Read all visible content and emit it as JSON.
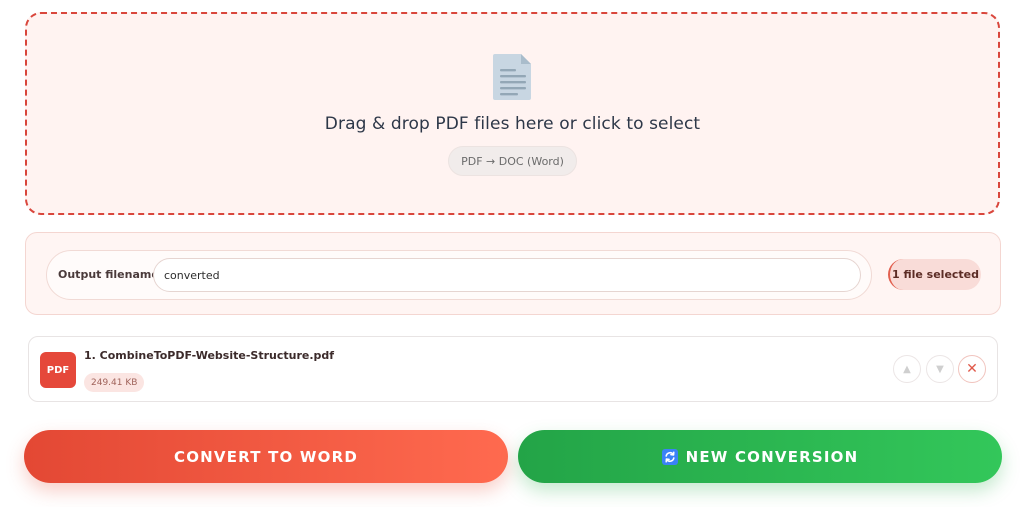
{
  "dropzone": {
    "title": "Drag & drop PDF files here or click to select",
    "badge": "PDF → DOC (Word)",
    "icon": "document-icon"
  },
  "options": {
    "filename_label": "Output filename:",
    "filename_value": "converted",
    "files_selected": "1 file selected"
  },
  "files": [
    {
      "thumb_label": "PDF",
      "name": "1. CombineToPDF-Website-Structure.pdf",
      "size": "249.41 KB"
    }
  ],
  "file_controls": {
    "up_icon": "▲",
    "down_icon": "▼",
    "remove_icon": "✕"
  },
  "actions": {
    "convert_label": "CONVERT TO WORD",
    "new_label": "NEW CONVERSION",
    "new_icon": "refresh-icon"
  },
  "colors": {
    "accent_red": "#e5483a",
    "accent_green": "#2bb552",
    "dropzone_bg": "#fff3f1"
  }
}
